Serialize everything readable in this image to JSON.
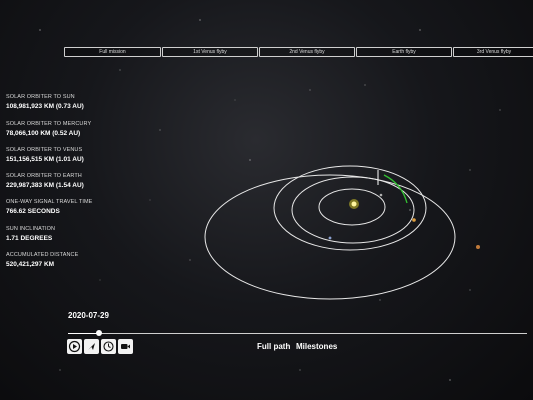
{
  "tabs": [
    "Full mission",
    "1st Venus flyby",
    "2nd Venus flyby",
    "Earth flyby",
    "3rd Venus flyby"
  ],
  "stats": [
    {
      "label": "SOLAR ORBITER TO SUN",
      "value": "108,981,923 KM (0.73 AU)"
    },
    {
      "label": "SOLAR ORBITER TO MERCURY",
      "value": "78,066,100 KM (0.52 AU)"
    },
    {
      "label": "SOLAR ORBITER TO VENUS",
      "value": "151,156,515 KM (1.01 AU)"
    },
    {
      "label": "SOLAR ORBITER TO EARTH",
      "value": "229,987,383 KM (1.54 AU)"
    },
    {
      "label": "ONE-WAY SIGNAL TRAVEL TIME",
      "value": "766.62 SECONDS"
    },
    {
      "label": "SUN INCLINATION",
      "value": "1.71 DEGREES"
    },
    {
      "label": "ACCUMULATED DISTANCE",
      "value": "520,421,297 KM"
    }
  ],
  "timeline": {
    "date": "2020-07-29",
    "progress": 0.068
  },
  "controls": [
    "play-icon",
    "navigate-icon",
    "speed-icon",
    "camera-icon"
  ],
  "modes": {
    "full_path": "Full path",
    "milestones": "Milestones"
  },
  "colors": {
    "sun": "#f6e627",
    "trajectory": "#33c233",
    "orbit": "#e8e8e8"
  }
}
